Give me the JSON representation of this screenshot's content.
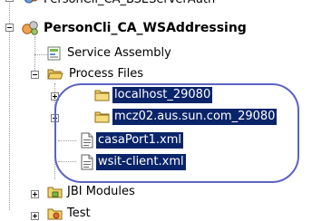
{
  "tree": {
    "top_partial": {
      "label": "PersonCli_CA_BSEServerAuth"
    },
    "project": {
      "label": "PersonCli_CA_WSAddressing",
      "expanded": true
    },
    "service_assembly": {
      "label": "Service Assembly"
    },
    "process_files": {
      "label": "Process Files",
      "expanded": true
    },
    "children": [
      {
        "label": "localhost_29080",
        "type": "folder",
        "expandable": true,
        "selected": true
      },
      {
        "label": "mcz02.aus.sun.com_29080",
        "type": "folder",
        "expandable": true,
        "selected": true
      },
      {
        "label": "casaPort1.xml",
        "type": "xml-file",
        "expandable": false,
        "selected": true
      },
      {
        "label": "wsit-client.xml",
        "type": "xml-file",
        "expandable": false,
        "selected": true
      }
    ],
    "jbi_modules": {
      "label": "JBI Modules",
      "expanded": false
    },
    "test": {
      "label": "Test",
      "expanded": false
    }
  },
  "colors": {
    "selection_bg": "#0a246a",
    "selection_fg": "#ffffff",
    "highlight_oval": "#5b63c2",
    "folder": "#f5d36b"
  }
}
